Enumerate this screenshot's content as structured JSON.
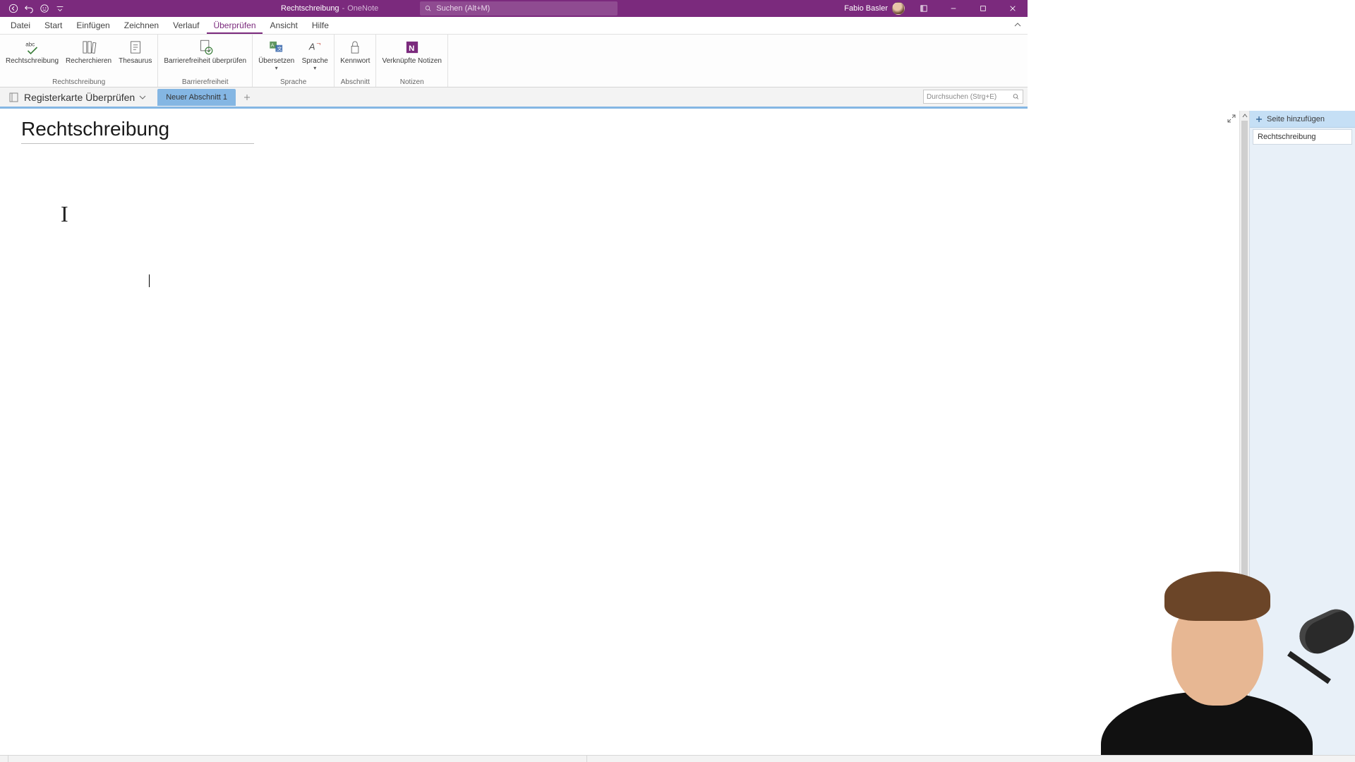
{
  "titlebar": {
    "doc_title": "Rechtschreibung",
    "app_name": "OneNote",
    "search_placeholder": "Suchen (Alt+M)",
    "user_name": "Fabio Basler"
  },
  "menu": {
    "tabs": [
      "Datei",
      "Start",
      "Einfügen",
      "Zeichnen",
      "Verlauf",
      "Überprüfen",
      "Ansicht",
      "Hilfe"
    ],
    "active_index": 5
  },
  "ribbon": {
    "groups": [
      {
        "label": "Rechtschreibung",
        "buttons": [
          {
            "label": "Rechtschreibung",
            "icon": "abc-check-icon"
          },
          {
            "label": "Recherchieren",
            "icon": "books-icon"
          },
          {
            "label": "Thesaurus",
            "icon": "thesaurus-icon"
          }
        ]
      },
      {
        "label": "Barrierefreiheit",
        "buttons": [
          {
            "label": "Barrierefreiheit überprüfen",
            "icon": "accessibility-icon"
          }
        ]
      },
      {
        "label": "Sprache",
        "buttons": [
          {
            "label": "Übersetzen",
            "icon": "translate-icon",
            "dropdown": true
          },
          {
            "label": "Sprache",
            "icon": "language-icon",
            "dropdown": true
          }
        ]
      },
      {
        "label": "Abschnitt",
        "buttons": [
          {
            "label": "Kennwort",
            "icon": "lock-icon"
          }
        ]
      },
      {
        "label": "Notizen",
        "buttons": [
          {
            "label": "Verknüpfte Notizen",
            "icon": "onenote-icon"
          }
        ]
      }
    ]
  },
  "notebook": {
    "name": "Registerkarte Überprüfen",
    "section_tab": "Neuer Abschnitt 1",
    "search_placeholder": "Durchsuchen (Strg+E)"
  },
  "page": {
    "title": "Rechtschreibung"
  },
  "pagelist": {
    "add_label": "Seite hinzufügen",
    "items": [
      "Rechtschreibung"
    ]
  }
}
